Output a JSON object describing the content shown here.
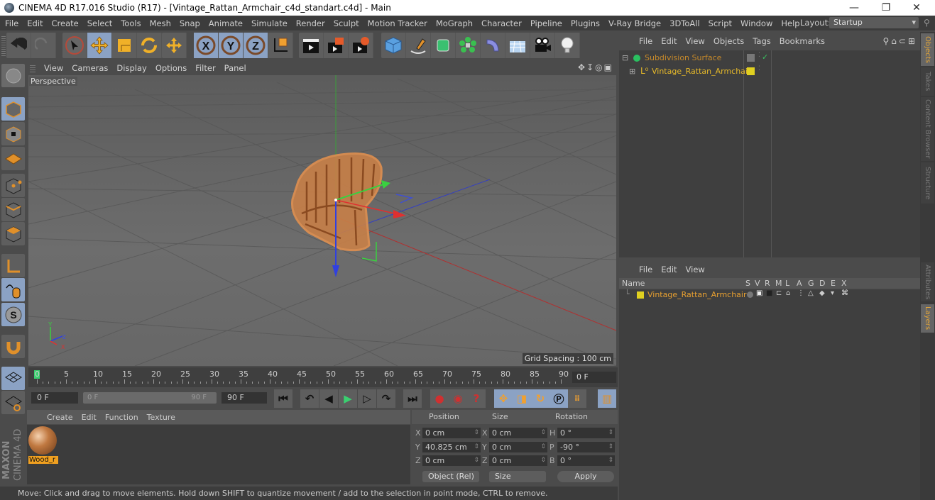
{
  "window": {
    "title": "CINEMA 4D R17.016 Studio (R17) - [Vintage_Rattan_Armchair_c4d_standart.c4d] - Main",
    "minimize": "—",
    "restore": "❐",
    "close": "✕"
  },
  "menubar": {
    "items": [
      "File",
      "Edit",
      "Create",
      "Select",
      "Tools",
      "Mesh",
      "Snap",
      "Animate",
      "Simulate",
      "Render",
      "Sculpt",
      "Motion Tracker",
      "MoGraph",
      "Character",
      "Pipeline",
      "Plugins",
      "V-Ray Bridge",
      "3DToAll",
      "Script",
      "Window",
      "Help"
    ],
    "layout_label": "Layout:",
    "layout_value": "Startup"
  },
  "toolbar": {
    "icons": [
      "undo-icon",
      "redo-icon",
      "live-selection-icon",
      "move-icon",
      "scale-icon",
      "rotate-icon",
      "recent-tool-icon",
      "x-axis-lock-icon",
      "y-axis-lock-icon",
      "z-axis-lock-icon",
      "coordinate-system-icon",
      "render-view-icon",
      "render-picture-viewer-icon",
      "render-settings-icon",
      "cube-icon",
      "pen-spline-icon",
      "subdivision-surface-icon",
      "cloner-icon",
      "deformer-icon",
      "floor-icon",
      "camera-icon",
      "light-icon"
    ]
  },
  "viewport": {
    "menu": [
      "View",
      "Cameras",
      "Display",
      "Options",
      "Filter",
      "Panel"
    ],
    "camera_label": "Perspective",
    "grid_spacing": "Grid Spacing : 100 cm",
    "axis_labels": {
      "x": "X",
      "y": "Y",
      "z": "Z"
    }
  },
  "timeline": {
    "ticks": [
      "0",
      "5",
      "10",
      "15",
      "20",
      "25",
      "30",
      "35",
      "40",
      "45",
      "50",
      "55",
      "60",
      "65",
      "70",
      "75",
      "80",
      "85",
      "90"
    ],
    "current_frame": "0 F",
    "start_field": "0 F",
    "range_start": "0 F",
    "range_end": "90 F",
    "end_field": "90 F"
  },
  "materials": {
    "menu": [
      "Create",
      "Edit",
      "Function",
      "Texture"
    ],
    "items": [
      {
        "name": "Wood_r"
      }
    ],
    "brand_top": "MAXON",
    "brand_bottom": "CINEMA 4D"
  },
  "coordinates": {
    "headers": [
      "Position",
      "Size",
      "Rotation"
    ],
    "position": [
      {
        "axis": "X",
        "value": "0 cm"
      },
      {
        "axis": "Y",
        "value": "40.825 cm"
      },
      {
        "axis": "Z",
        "value": "0 cm"
      }
    ],
    "size": [
      {
        "axis": "X",
        "value": "0 cm"
      },
      {
        "axis": "Y",
        "value": "0 cm"
      },
      {
        "axis": "Z",
        "value": "0 cm"
      }
    ],
    "rotation": [
      {
        "axis": "H",
        "value": "0 °"
      },
      {
        "axis": "P",
        "value": "-90 °"
      },
      {
        "axis": "B",
        "value": "0 °"
      }
    ],
    "mode_select": "Object (Rel)",
    "size_select": "Size",
    "apply": "Apply"
  },
  "status": {
    "text": "Move: Click and drag to move elements. Hold down SHIFT to quantize movement / add to the selection in point mode, CTRL to remove."
  },
  "objects": {
    "menu": [
      "File",
      "Edit",
      "View",
      "Objects",
      "Tags",
      "Bookmarks"
    ],
    "items": [
      {
        "name": "Subdivision Surface",
        "color": "#c78a2a"
      },
      {
        "name": "Vintage_Rattan_Armchair",
        "color": "#e6b92a"
      }
    ]
  },
  "layers": {
    "menu": [
      "File",
      "Edit",
      "View"
    ],
    "columns": {
      "name": "Name",
      "flags": [
        "S",
        "V",
        "R",
        "M",
        "L",
        "A",
        "G",
        "D",
        "E",
        "X"
      ]
    },
    "items": [
      {
        "name": "Vintage_Rattan_Armchair",
        "color": "#e0d020"
      }
    ]
  },
  "right_tabs": [
    "Objects",
    "Takes",
    "Content Browser",
    "Structure",
    "Attributes",
    "Layers"
  ],
  "colors": {
    "accent": "#e8a030",
    "selected_tool": "#8ba2c4",
    "background": "#4b4b4b"
  }
}
